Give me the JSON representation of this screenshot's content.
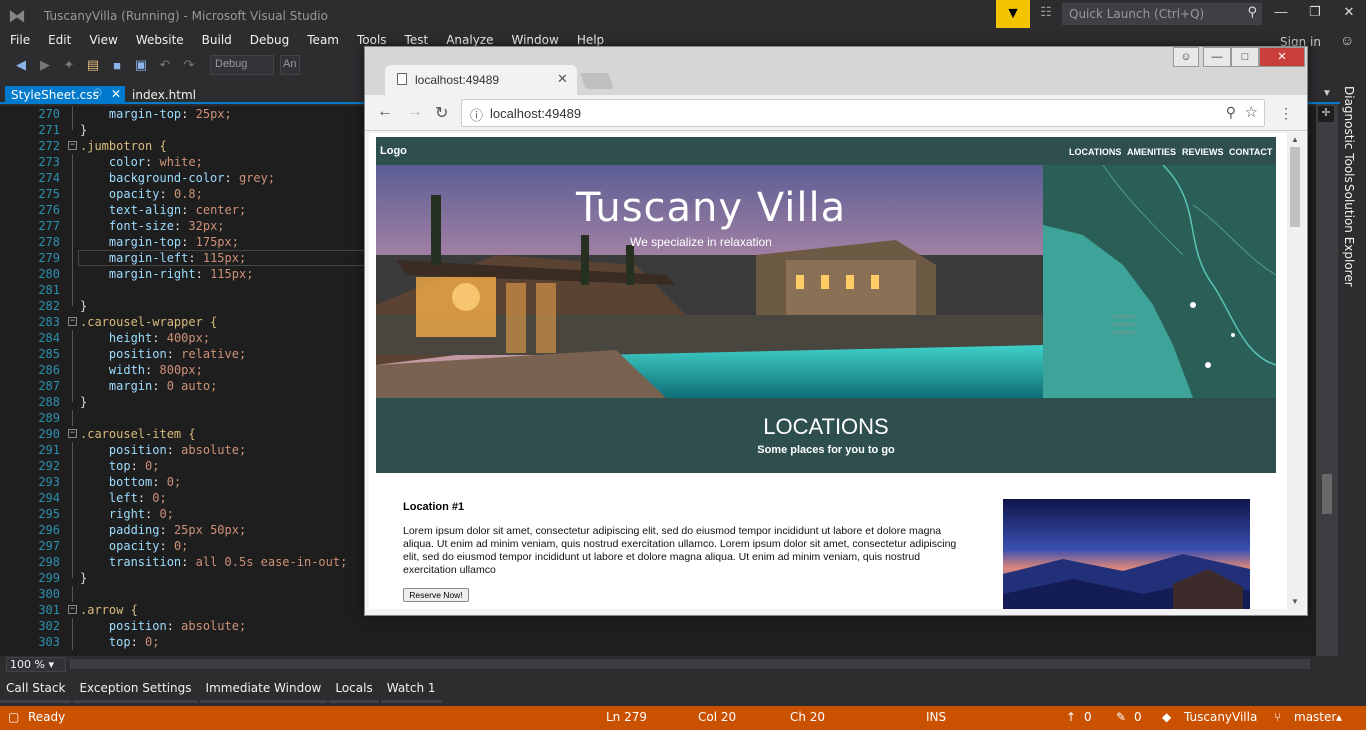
{
  "window": {
    "title": "TuscanyVilla (Running) - Microsoft Visual Studio",
    "quick_launch_placeholder": "Quick Launch (Ctrl+Q)",
    "sign_in": "Sign in"
  },
  "menu": [
    "File",
    "Edit",
    "View",
    "Website",
    "Build",
    "Debug",
    "Team",
    "Tools",
    "Test",
    "Analyze",
    "Window",
    "Help"
  ],
  "toolbar": {
    "config": "Debug",
    "platform": "An"
  },
  "tabs": {
    "active": "StyleSheet.css",
    "other": "index.html"
  },
  "code_lines": [
    {
      "n": "270",
      "t": "    margin-top: 25px;"
    },
    {
      "n": "271",
      "t": "}"
    },
    {
      "n": "272",
      "t": ".jumbotron {"
    },
    {
      "n": "273",
      "t": "    color: white;"
    },
    {
      "n": "274",
      "t": "    background-color: grey;"
    },
    {
      "n": "275",
      "t": "    opacity: 0.8;"
    },
    {
      "n": "276",
      "t": "    text-align: center;"
    },
    {
      "n": "277",
      "t": "    font-size: 32px;"
    },
    {
      "n": "278",
      "t": "    margin-top: 175px;"
    },
    {
      "n": "279",
      "t": "    margin-left: 115px;"
    },
    {
      "n": "280",
      "t": "    margin-right: 115px;"
    },
    {
      "n": "281",
      "t": ""
    },
    {
      "n": "282",
      "t": "}"
    },
    {
      "n": "283",
      "t": ".carousel-wrapper {"
    },
    {
      "n": "284",
      "t": "    height: 400px;"
    },
    {
      "n": "285",
      "t": "    position: relative;"
    },
    {
      "n": "286",
      "t": "    width: 800px;"
    },
    {
      "n": "287",
      "t": "    margin: 0 auto;"
    },
    {
      "n": "288",
      "t": "}"
    },
    {
      "n": "289",
      "t": ""
    },
    {
      "n": "290",
      "t": ".carousel-item {"
    },
    {
      "n": "291",
      "t": "    position: absolute;"
    },
    {
      "n": "292",
      "t": "    top: 0;"
    },
    {
      "n": "293",
      "t": "    bottom: 0;"
    },
    {
      "n": "294",
      "t": "    left: 0;"
    },
    {
      "n": "295",
      "t": "    right: 0;"
    },
    {
      "n": "296",
      "t": "    padding: 25px 50px;"
    },
    {
      "n": "297",
      "t": "    opacity: 0;"
    },
    {
      "n": "298",
      "t": "    transition: all 0.5s ease-in-out;"
    },
    {
      "n": "299",
      "t": "}"
    },
    {
      "n": "300",
      "t": ""
    },
    {
      "n": "301",
      "t": ".arrow {"
    },
    {
      "n": "302",
      "t": "    position: absolute;"
    },
    {
      "n": "303",
      "t": "    top: 0;"
    }
  ],
  "side_tabs": [
    "Diagnostic Tools",
    "Solution Explorer"
  ],
  "zoom": "100 %",
  "tool_tabs": [
    "Call Stack",
    "Exception Settings",
    "Immediate Window",
    "Locals",
    "Watch 1"
  ],
  "status": {
    "ready": "Ready",
    "ln": "Ln 279",
    "col": "Col 20",
    "ch": "Ch 20",
    "ins": "INS",
    "up": "0",
    "edits": "0",
    "project": "TuscanyVilla",
    "branch": "master"
  },
  "browser": {
    "tab_title": "localhost:49489",
    "address": "localhost:49489"
  },
  "site": {
    "logo": "Logo",
    "nav": [
      "LOCATIONS",
      "AMENITIES",
      "REVIEWS",
      "CONTACT"
    ],
    "hero_title": "Tuscany Villa",
    "hero_sub": "We specialize in relaxation",
    "section_title": "LOCATIONS",
    "section_sub": "Some places for you to go",
    "loc1_name": "Location #1",
    "loc1_text": "Lorem ipsum dolor sit amet, consectetur adipiscing elit, sed do eiusmod tempor incididunt ut labore et dolore magna aliqua. Ut enim ad minim veniam, quis nostrud exercitation ullamco. Lorem ipsum dolor sit amet, consectetur adipiscing elit, sed do eiusmod tempor incididunt ut labore et dolore magna aliqua. Ut enim ad minim veniam, quis nostrud exercitation ullamco",
    "reserve": "Reserve Now!"
  },
  "colors": {
    "accent": "#007acc",
    "status_bar": "#ca5100",
    "site_teal": "#2f4f4f"
  }
}
